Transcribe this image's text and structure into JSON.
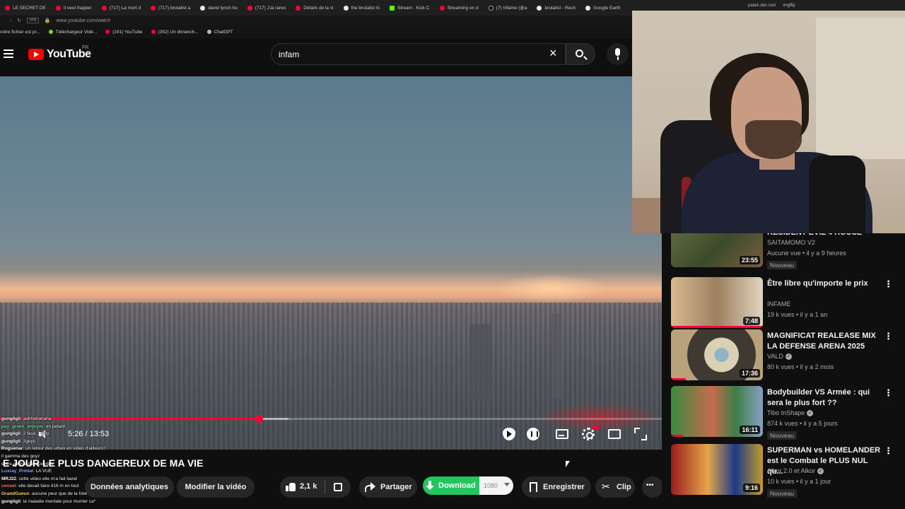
{
  "browser": {
    "tabs": [
      {
        "label": "LE SECRET DE",
        "icon": "youtube"
      },
      {
        "label": "Il veut frapper",
        "icon": "youtube"
      },
      {
        "label": "(717) La mort d",
        "icon": "youtube"
      },
      {
        "label": "(717) brutalist a",
        "icon": "youtube"
      },
      {
        "label": "david lynch ho",
        "icon": "google"
      },
      {
        "label": "(717) J'ai rareo",
        "icon": "youtube"
      },
      {
        "label": "Détails de la vi",
        "icon": "youtube"
      },
      {
        "label": "the brutalist hi",
        "icon": "google"
      },
      {
        "label": "Stream - Kick C",
        "icon": "kick"
      },
      {
        "label": "Streaming en d",
        "icon": "youtube"
      },
      {
        "label": "(7) Infame (@a",
        "icon": "x"
      },
      {
        "label": "brutalist - Rech",
        "icon": "google"
      },
      {
        "label": "Google Earth",
        "icon": "google"
      }
    ],
    "address": "www.youtube.com/watch",
    "bookmarks": [
      {
        "label": "votre fichier est pr...",
        "icon": "none"
      },
      {
        "label": "Téléchargeur Vidé...",
        "icon": "download"
      },
      {
        "label": "(191) YouTube",
        "icon": "youtube"
      },
      {
        "label": "(352) Un dimanch...",
        "icon": "youtube"
      },
      {
        "label": "ChatGPT",
        "icon": "chatgpt"
      }
    ],
    "webcam_tabs": [
      "palais des sovi",
      "imgflip"
    ]
  },
  "youtube": {
    "logo_text": "YouTube",
    "region": "FR",
    "search_value": "infam",
    "clear_icon": "×"
  },
  "player": {
    "time": "5:26 / 13:53",
    "progress_fraction": 0.391,
    "buffered_fraction": 0.436
  },
  "chat": [
    {
      "user": "gungligli",
      "msg": "aahhahahaha",
      "color": "#ffffff"
    },
    {
      "user": "pay_green_enjoyer",
      "msg": "en petant",
      "color": "#7fd97f"
    },
    {
      "user": "gungligli",
      "msg": "2 faux... 6Oy",
      "color": "#ffffff"
    },
    {
      "user": "gungligli",
      "msg": "2goys",
      "color": "#ffffff"
    },
    {
      "user": "Roguenar",
      "msg": "un retour des urbex en vidéo d'ailleurs?",
      "color": "#ffffff"
    },
    {
      "user": "",
      "msg": "il gamma des goyz",
      "color": "#ffffff"
    },
    {
      "user": "",
      "msg": "entre amin   a decouvertee",
      "color": "#ffffff"
    },
    {
      "user": "Luxray_Primal",
      "msg": "LA VUE",
      "color": "#8fa8ff"
    },
    {
      "user": "MRJ22",
      "msg": "cette video elle m'a fait band",
      "color": "#ffffff"
    },
    {
      "user": "censet",
      "msg": "elle devait faire 416 m en tout",
      "color": "#ff7070"
    },
    {
      "user": "GrandGueux",
      "msg": "aucune peur que de la folie",
      "color": "#ffd36b"
    },
    {
      "user": "gungligli",
      "msg": "la maladie mentale pour monter ca*",
      "color": "#ffffff"
    }
  ],
  "video": {
    "title": "E JOUR LE PLUS DANGEREUX DE MA VIE",
    "actions": {
      "analytics": "Données analytiques",
      "modify": "Modifier la vidéo",
      "likes": "2,1 k",
      "share": "Partager",
      "download": "Download",
      "quality": "1080",
      "save": "Enregistrer",
      "clip": "Clip"
    }
  },
  "related": [
    {
      "title": "RESIDENT EVIL 4 HOUSE",
      "channel": "SAITAMOMO V2",
      "verified": false,
      "meta": "Aucune vue • il y a 9 heures",
      "duration": "23:55",
      "badge": "Nouveau",
      "progress_fraction": 0,
      "thumb": "soldiers"
    },
    {
      "title": "Être libre qu'importe le prix",
      "channel": "INFAME",
      "verified": false,
      "meta": "19 k vues • il y a 1 an",
      "duration": "7:48",
      "badge": "",
      "progress_fraction": 1,
      "thumb": "libre"
    },
    {
      "title": "MAGNIFICAT REALEASE MIX LA DEFENSE ARENA 2025",
      "channel": "VALD",
      "verified": true,
      "meta": "80 k vues • il y a 2 mois",
      "duration": "17:36",
      "badge": "",
      "progress_fraction": 0.16,
      "thumb": "eye"
    },
    {
      "title": "Bodybuilder VS Armée : qui sera le plus fort ??",
      "channel": "Tibo InShape",
      "verified": true,
      "meta": "874 k vues • il y a 5 jours",
      "duration": "16:11",
      "badge": "Nouveau",
      "progress_fraction": 0.13,
      "thumb": "army"
    },
    {
      "title": "SUPERMAN vs HOMELANDER est le Combat le PLUS NUL qu...",
      "channel": "Alkor 2.0 et Alkor",
      "verified": true,
      "meta": "10 k vues • il y a 1 jour",
      "duration": "9:16",
      "badge": "Nouveau",
      "progress_fraction": 0,
      "thumb": "superman"
    }
  ],
  "colors": {
    "accent": "#ff0033",
    "download": "#22c55e",
    "background": "#0f0f0f"
  }
}
